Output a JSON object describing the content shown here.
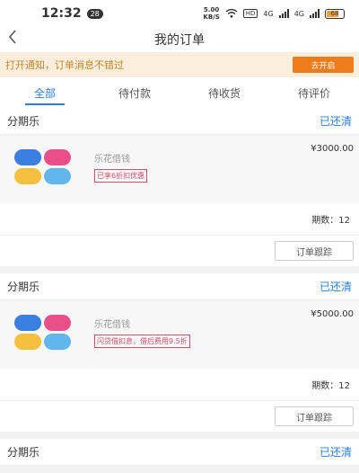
{
  "status_bar": {
    "time": "12:32",
    "notification_count": "28",
    "net_speed": "5.00",
    "net_unit": "KB/S",
    "hd_label": "HD",
    "signal_1": "4G",
    "signal_2": "4G",
    "battery_percent": "68"
  },
  "nav": {
    "title": "我的订单",
    "back_icon": "chevron-left-icon"
  },
  "notice": {
    "text": "打开通知，订单消息不错过",
    "button": "去开启"
  },
  "tabs": [
    {
      "label": "全部",
      "active": true
    },
    {
      "label": "待付款",
      "active": false
    },
    {
      "label": "待收货",
      "active": false
    },
    {
      "label": "待评价",
      "active": false
    }
  ],
  "orders": [
    {
      "merchant": "分期乐",
      "status": "已还清",
      "product": "乐花借钱",
      "tag": "已享6折扣优惠",
      "price": "¥3000.00",
      "terms": "期数：12",
      "action": "订单跟踪"
    },
    {
      "merchant": "分期乐",
      "status": "已还清",
      "product": "乐花借钱",
      "tag": "闪贷借扣息，借后费用9.5折",
      "price": "¥5000.00",
      "terms": "期数：12",
      "action": "订单跟踪"
    },
    {
      "merchant": "分期乐",
      "status": "已还清"
    }
  ],
  "colors": {
    "accent": "#2a7de1",
    "notice_bg": "#fbeedc",
    "notice_button": "#ef7c1a",
    "tag": "#d5506f"
  }
}
